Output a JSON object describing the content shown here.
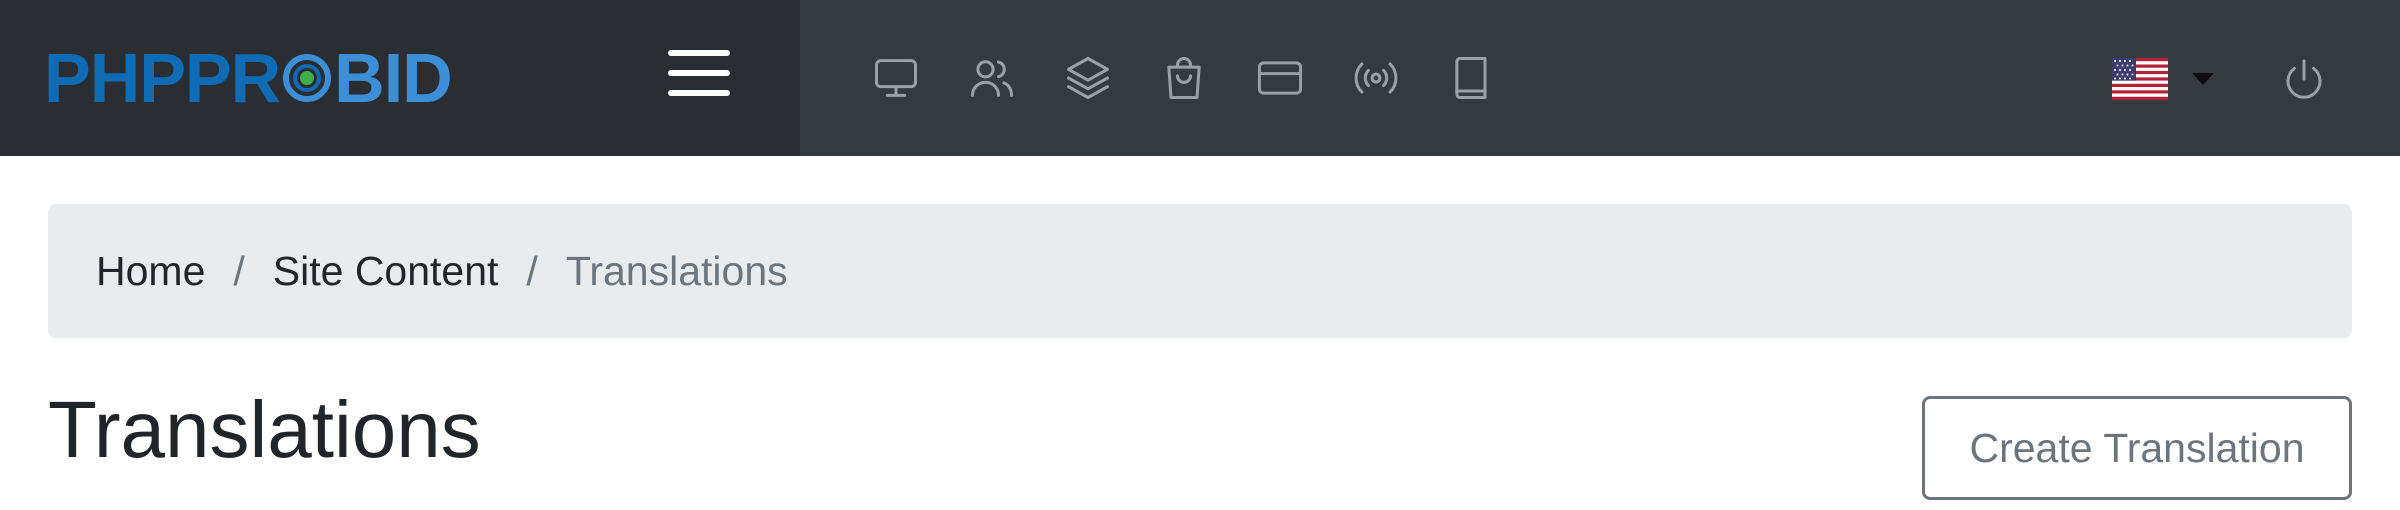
{
  "header": {
    "logo": {
      "part1": "PHPPR",
      "part2": "BID"
    },
    "menu_toggle_icon": "hamburger-icon",
    "nav_icons": [
      "monitor-icon",
      "users-icon",
      "layers-icon",
      "shopping-bag-icon",
      "credit-card-icon",
      "broadcast-icon",
      "book-icon"
    ],
    "language_flag": "us-flag-icon",
    "power_icon": "power-icon",
    "colors": {
      "topbar": "#343a40",
      "brand_area": "#2a2d31",
      "logo_dark_blue": "#0e6bb4",
      "logo_light_blue": "#3c8ed6",
      "logo_center_dot": "#3fae49"
    }
  },
  "breadcrumb": {
    "items": [
      {
        "label": "Home"
      },
      {
        "label": "Site Content"
      },
      {
        "label": "Translations"
      }
    ],
    "separator": "/"
  },
  "page": {
    "title": "Translations",
    "create_button": "Create Translation"
  }
}
